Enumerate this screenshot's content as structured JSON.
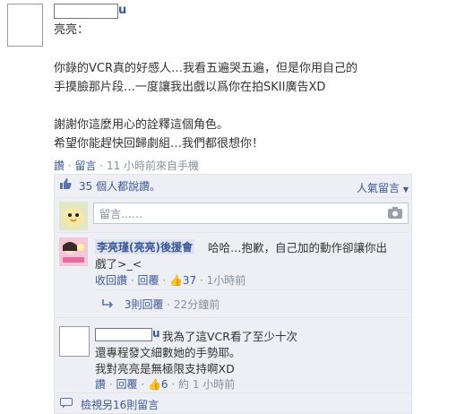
{
  "post": {
    "author_suffix": "u",
    "greeting": "亮亮：",
    "lines": [
      "你錄的VCR真的好感人…我看五遍哭五遍，但是你用自己的",
      "手摸臉那片段…一度讓我出戲以爲你在拍SKII廣告XD",
      "謝謝你這麼用心的詮釋這個角色。",
      "希望你能趕快回歸劇組…我們都很想你！"
    ],
    "actions": {
      "like": "讚",
      "comment": "留言",
      "meta": "· 11 小時前來自手機"
    }
  },
  "likes_bar": {
    "count_text": "35 個人都說讚。",
    "sort_label": "人氣留言"
  },
  "comment_input": {
    "placeholder": "留言……"
  },
  "comment1": {
    "author": "李亮瑾(亮亮)後援會",
    "text_line1": "哈哈…抱歉，自己加的動作卻讓你出",
    "text_line2": "戲了>_<",
    "unlike": "收回讚",
    "reply": "回覆",
    "like_count": "37",
    "time": "1小時前",
    "replies_link": "3則回覆",
    "replies_time": "· 22分鐘前"
  },
  "comment2": {
    "author_suffix": "u",
    "text_line1": "我為了這VCR看了至少十次",
    "text_line2": "還專程發文細數她的手勢耶。",
    "text_line3": "我對亮亮是無極限支持啊XD",
    "like": "讚",
    "reply": "回覆",
    "like_count": "6",
    "time": "約 1 小時前"
  },
  "view_more": "檢視另16則留言",
  "colors": {
    "link": "#3b5998",
    "panel": "#edeff4",
    "muted": "#898f9c"
  }
}
